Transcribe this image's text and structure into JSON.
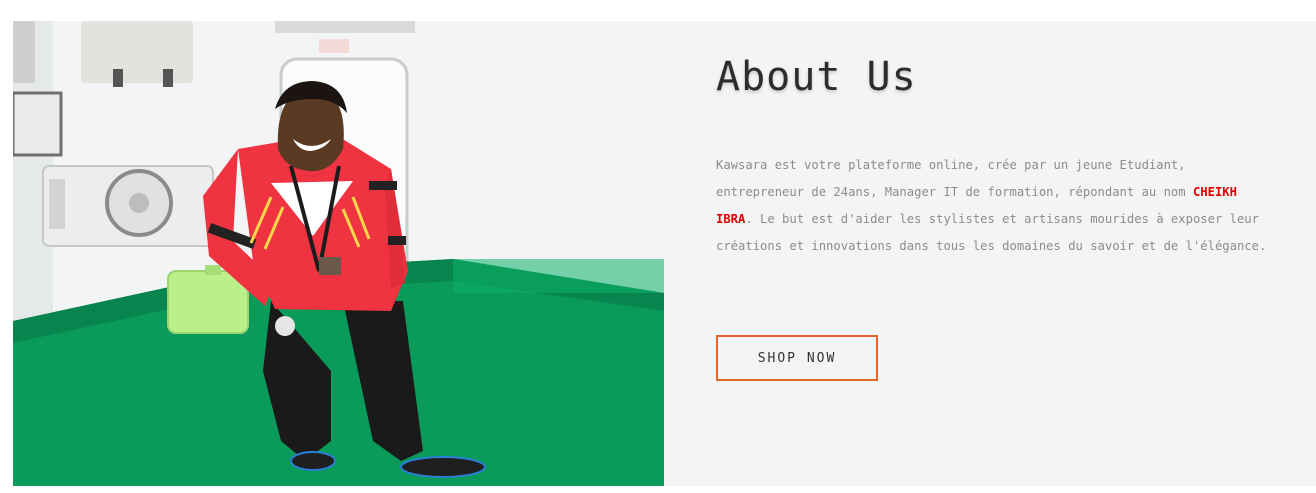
{
  "about": {
    "title": "About Us",
    "paragraph_before": "Kawsara est votre plateforme online, crée par un jeune Etudiant, entrepreneur de 24ans, Manager IT de formation, répondant au nom ",
    "highlight_name": "CHEIKH IBRA",
    "paragraph_after": ". Le but est d'aider les stylistes et artisans mourides à exposer leur créations et innovations dans tous les domaines du savoir et de l'élégance.",
    "button_label": "SHOP NOW"
  },
  "colors": {
    "accent": "#e8642b",
    "highlight": "#e00000",
    "panel_bg": "#f3f4f4",
    "text": "#8c8c8c",
    "floor": "#0a9a5a"
  },
  "photo": {
    "alt": "Young man in red hoodie standing on a green ship deck"
  }
}
